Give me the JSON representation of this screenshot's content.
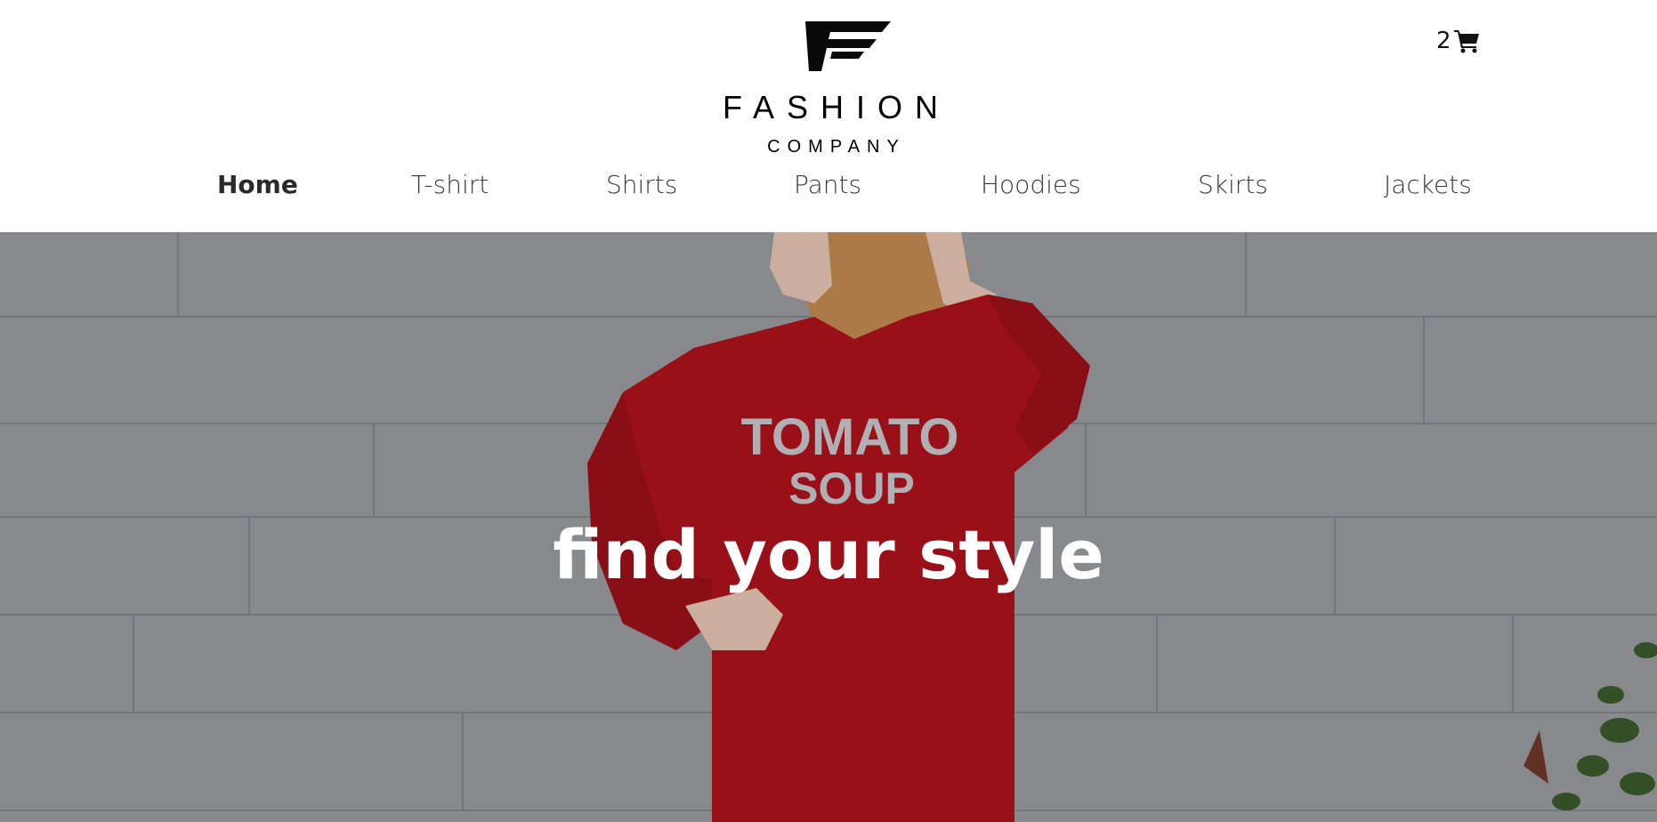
{
  "brand": {
    "name": "FASHION",
    "sub": "COMPANY",
    "logo_icon": "winged-f-icon"
  },
  "cart": {
    "count": "2",
    "icon": "cart-icon"
  },
  "nav": {
    "items": [
      {
        "label": "Home",
        "active": true
      },
      {
        "label": "T-shirt",
        "active": false
      },
      {
        "label": "Shirts",
        "active": false
      },
      {
        "label": "Pants",
        "active": false
      },
      {
        "label": "Hoodies",
        "active": false
      },
      {
        "label": "Skirts",
        "active": false
      },
      {
        "label": "Jackets",
        "active": false
      }
    ]
  },
  "hero": {
    "title": "find your style",
    "sweater_text_line1": "TOMATO",
    "sweater_text_line2": "SOUP",
    "colors": {
      "overlay": "#8f9297",
      "sweater": "#b0131c",
      "hair": "#c98a4a",
      "skin": "#e8c6b4",
      "plant": "#3a5a2c"
    }
  }
}
